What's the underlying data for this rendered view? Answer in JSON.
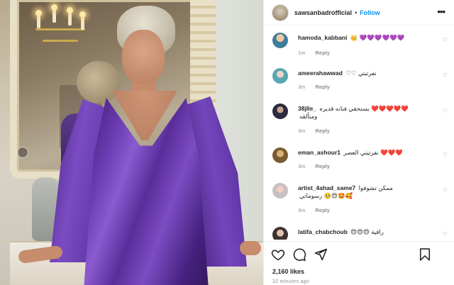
{
  "post": {
    "username": "sawsanbadrofficial",
    "separator": "•",
    "follow_label": "Follow",
    "more_label": "•••"
  },
  "comments": [
    {
      "user": "hamoda_kabbani",
      "text": "👑 💜💜💜💜💜💜",
      "time": "1m",
      "reply": "Reply",
      "avatar": "avatar-man"
    },
    {
      "user": "ameerahawwad",
      "text": "♡♡ نفرتيتي",
      "time": "3m",
      "reply": "Reply",
      "avatar": "avatar-woman"
    },
    {
      "user": "38jlle_",
      "text": "بستحقي فنانه قديره ❤️❤️❤️❤️❤️",
      "text2": "ومتألقه",
      "time": "3m",
      "reply": "Reply",
      "avatar": "avatar-dark"
    },
    {
      "user": "eman_ashour1",
      "text": "نفرتيتي العصر ❤️❤️❤️",
      "time": "3m",
      "reply": "Reply",
      "avatar": "avatar-cat"
    },
    {
      "user": "artist_4ahad_same7",
      "text": "ممكن تشوفوا",
      "text2": "رسوماتي 🥺😍🤩🥰",
      "time": "3m",
      "reply": "Reply",
      "avatar": "avatar-girl"
    },
    {
      "user": "latifa_chabchoub",
      "text": "😍😍😍 راقية",
      "time": "",
      "reply": "",
      "avatar": "avatar-woman2"
    }
  ],
  "icons": {
    "like": "heart-outline-icon",
    "comment": "comment-bubble-icon",
    "share": "paper-plane-icon",
    "save": "bookmark-icon",
    "comment_like": "small-heart-icon"
  },
  "likes": "2,160 likes",
  "timestamp": "32 minutes ago",
  "colors": {
    "accent": "#0095f6",
    "text": "#262626",
    "muted": "#8e8e8e",
    "dress": "#6a3bb0"
  }
}
